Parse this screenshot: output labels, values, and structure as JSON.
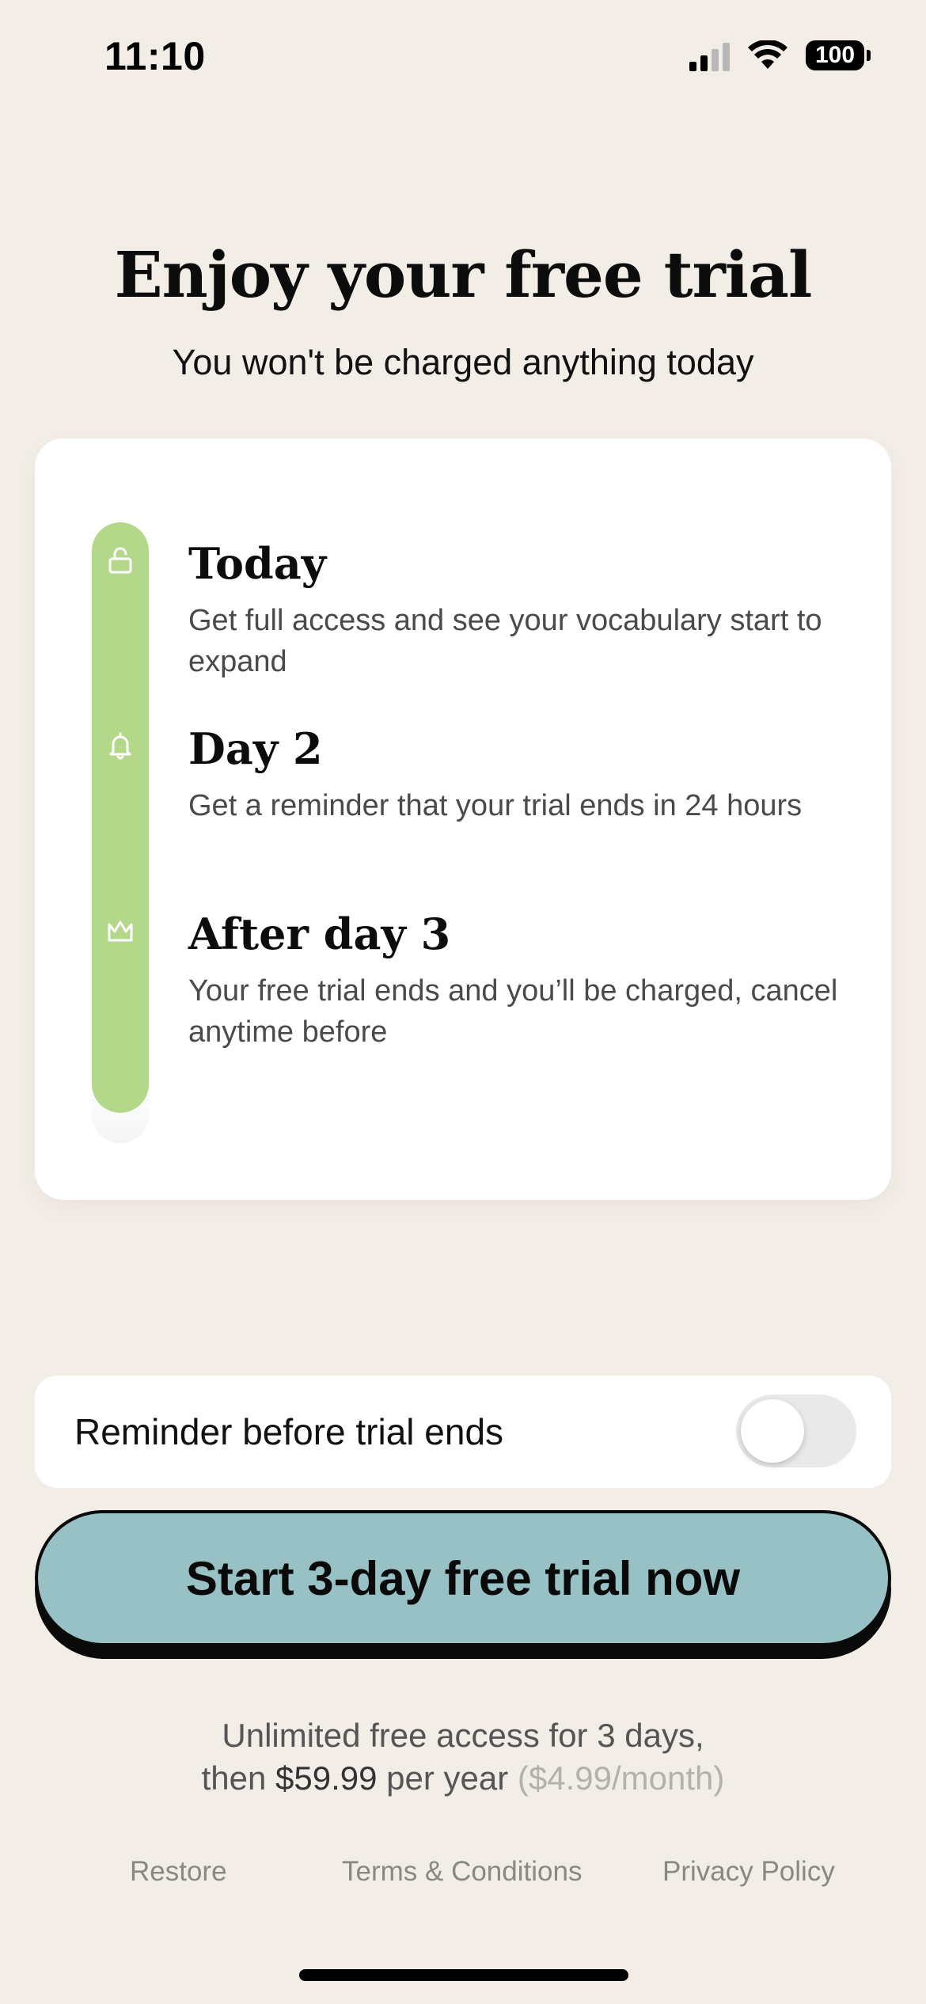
{
  "status_bar": {
    "time": "11:10",
    "battery": "100"
  },
  "header": {
    "title": "Enjoy your free trial",
    "subtitle": "You won't be charged anything today"
  },
  "timeline": {
    "accent_color": "#b3d889",
    "steps": [
      {
        "icon": "unlock-icon",
        "title": "Today",
        "description": "Get full access and see your vocabulary start to expand"
      },
      {
        "icon": "bell-icon",
        "title": "Day 2",
        "description": "Get a reminder that your trial ends in 24 hours"
      },
      {
        "icon": "crown-icon",
        "title": "After day 3",
        "description": "Your free trial ends and you’ll be charged, cancel anytime before"
      }
    ]
  },
  "reminder": {
    "label": "Reminder before trial ends",
    "enabled": false
  },
  "cta": {
    "label": "Start 3-day free trial now",
    "color": "#97c1c4"
  },
  "pricing": {
    "line1": "Unlimited free access for 3 days,",
    "line2_prefix": "then ",
    "price": "$59.99",
    "line2_mid": " per year ",
    "monthly": "($4.99/month)"
  },
  "footer": {
    "restore": "Restore",
    "terms": "Terms & Conditions",
    "privacy": "Privacy Policy"
  }
}
